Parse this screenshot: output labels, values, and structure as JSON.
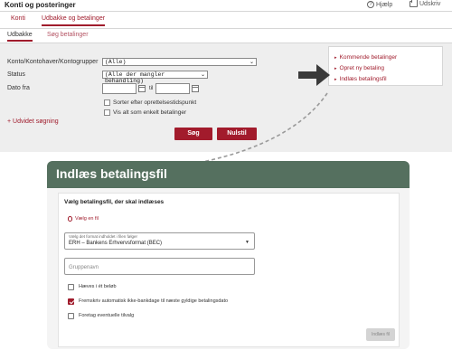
{
  "titlebar": {
    "title": "Konti og posteringer",
    "help_label": "Hjælp",
    "print_label": "Udskriv"
  },
  "tabs": [
    "Konti",
    "Udbakke og betalinger"
  ],
  "subtabs": [
    "Udbakke",
    "Søg betalinger"
  ],
  "form": {
    "konto_label": "Konto/Kontohaver/Kontogrupper",
    "konto_value": "(Alle)",
    "status_label": "Status",
    "status_value": "(Alle der mangler behandling)",
    "dato_label": "Dato fra",
    "til_label": "til",
    "sort_label": "Sorter efter oprettelsestidspunkt",
    "enkelt_label": "Vis alt som enkelt betalinger",
    "udvidet_label": "+ Udvidet søgning",
    "search_button": "Søg",
    "reset_button": "Nulstil"
  },
  "side_menu": [
    "Kommende betalinger",
    "Opret ny betaling",
    "Indlæs betalingsfil"
  ],
  "modal": {
    "title": "Indlæs betalingsfil",
    "subtitle": "Vælg betalingsfil, der skal indlæses",
    "choose_file": "Vælg en fil",
    "format_label": "Vælg det format indholdet i filen følger",
    "format_value": "ERH – Bankens Erhvervsformat (BEC)",
    "group_placeholder": "Gruppenavn",
    "checkbox_1": "Hæves i ét beløb",
    "checkbox_2": "Fremskriv automatisk ikke-bankdage til næste gyldige betalingsdato",
    "checkbox_3": "Foretag eventuelle tilvalg",
    "checkbox_2_checked": true,
    "submit_button": "Indlæs fil"
  },
  "colors": {
    "accent": "#a01c2c",
    "header_green": "#55705f"
  }
}
